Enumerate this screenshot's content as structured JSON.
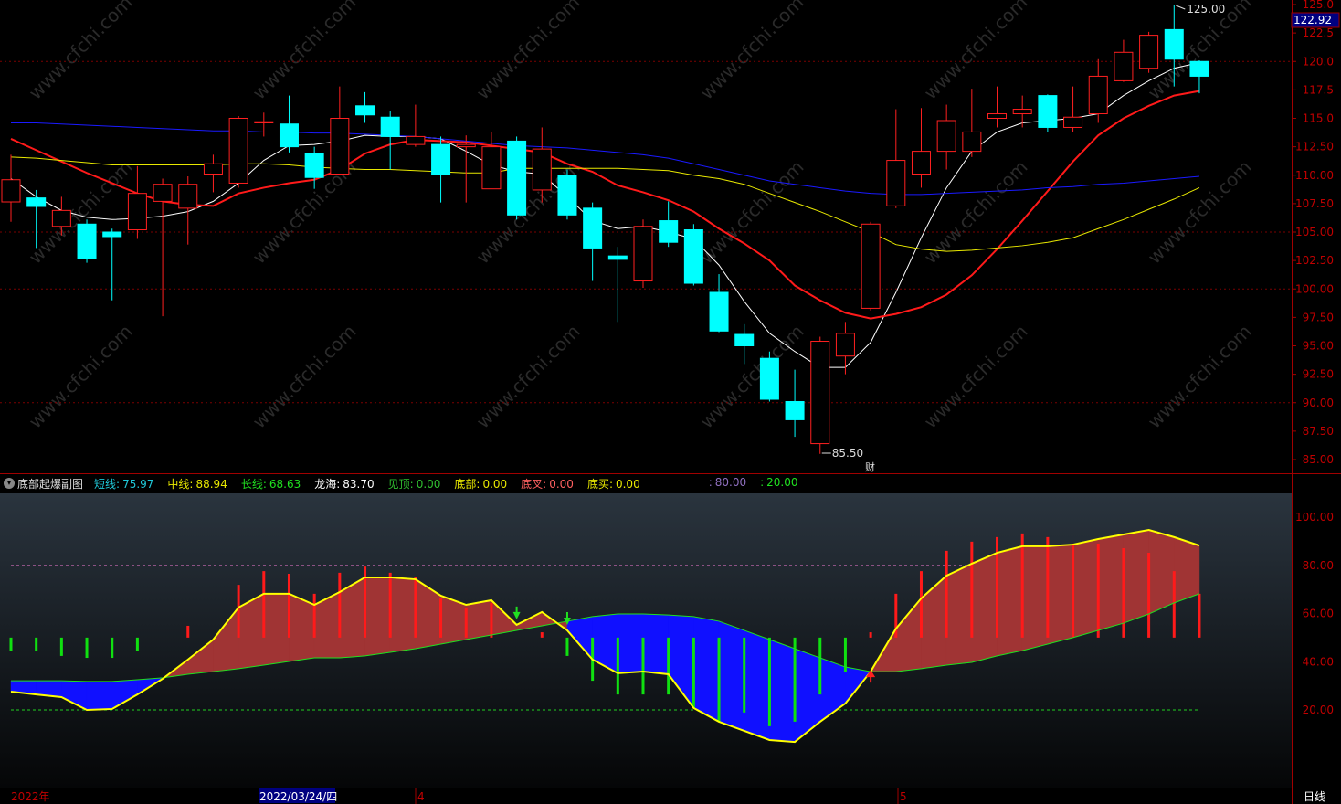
{
  "colors": {
    "up": "#ff2020",
    "down": "#00ffff",
    "ma5": "#ffffff",
    "ma10": "#ff1a1a",
    "ma20": "#e8e800",
    "ma60": "#1a1aff",
    "axis": "#a00000",
    "bg": "#000000"
  },
  "watermark": "www.cfchi.com",
  "price_axis": {
    "ticks": [
      "125.0",
      "122.5",
      "120.0",
      "117.5",
      "115.0",
      "112.50",
      "110.00",
      "107.50",
      "105.00",
      "102.50",
      "100.00",
      "97.50",
      "95.00",
      "92.50",
      "90.00",
      "87.50",
      "85.00"
    ],
    "current": "122.92"
  },
  "markers": {
    "high": "125.00",
    "low": "85.50",
    "event": "财"
  },
  "indicator": {
    "title": "底部起爆副图",
    "items": [
      {
        "label": "短线:",
        "value": "75.97",
        "color": "#20c8d8"
      },
      {
        "label": "中线:",
        "value": "88.94",
        "color": "#e8e800"
      },
      {
        "label": "长线:",
        "value": "68.63",
        "color": "#20e020"
      },
      {
        "label": "龙海:",
        "value": "83.70",
        "color": "#ffffff"
      },
      {
        "label": "见顶:",
        "value": "0.00",
        "color": "#30c030"
      },
      {
        "label": "底部:",
        "value": "0.00",
        "color": "#e8e800"
      },
      {
        "label": "底叉:",
        "value": "0.00",
        "color": "#ff6060"
      },
      {
        "label": "底买:",
        "value": "0.00",
        "color": "#e8e800"
      },
      {
        "label": ":",
        "value": "80.00",
        "color": "#9070c0"
      },
      {
        "label": ":",
        "value": "20.00",
        "color": "#20e020"
      }
    ],
    "axis_ticks": [
      "100.00",
      "80.00",
      "60.00",
      "40.00",
      "20.00"
    ]
  },
  "time_axis": {
    "labels": [
      "2022年",
      "4",
      "5"
    ],
    "cursor_date": "2022/03/24/四",
    "period": "日线"
  },
  "chart_data": [
    {
      "type": "candlestick",
      "title": "Price",
      "ylim": [
        85,
        125
      ],
      "candles": [
        [
          107.65,
          111.8,
          105.9,
          109.6
        ],
        [
          108.0,
          108.7,
          103.6,
          107.25
        ],
        [
          105.5,
          108.1,
          104.7,
          106.9
        ],
        [
          105.7,
          106.1,
          102.3,
          102.7
        ],
        [
          105.0,
          105.3,
          99.0,
          104.6
        ],
        [
          105.2,
          110.8,
          104.4,
          108.4
        ],
        [
          107.7,
          109.7,
          97.6,
          109.2
        ],
        [
          107.1,
          109.9,
          103.9,
          109.2
        ],
        [
          110.1,
          111.8,
          108.5,
          111.0
        ],
        [
          109.3,
          115.2,
          108.9,
          115.0
        ],
        [
          114.6,
          115.5,
          113.4,
          114.7
        ],
        [
          114.5,
          117.0,
          112.0,
          112.5
        ],
        [
          111.9,
          112.5,
          108.8,
          109.8
        ],
        [
          110.1,
          117.8,
          110.0,
          115.0
        ],
        [
          116.1,
          117.3,
          114.6,
          115.3
        ],
        [
          115.1,
          115.6,
          110.5,
          113.4
        ],
        [
          112.7,
          116.2,
          112.5,
          113.4
        ],
        [
          112.7,
          113.4,
          107.6,
          110.1
        ],
        [
          112.5,
          113.5,
          107.6,
          112.7
        ],
        [
          108.8,
          113.8,
          108.8,
          112.5
        ],
        [
          113.0,
          113.4,
          106.1,
          106.5
        ],
        [
          108.7,
          114.2,
          107.6,
          112.3
        ],
        [
          110.0,
          110.5,
          106.1,
          106.5
        ],
        [
          107.1,
          107.6,
          100.7,
          103.6
        ],
        [
          102.9,
          103.7,
          97.1,
          102.6
        ],
        [
          100.7,
          106.1,
          100.1,
          105.5
        ],
        [
          106.0,
          107.7,
          103.7,
          104.1
        ],
        [
          105.2,
          105.7,
          100.3,
          100.5
        ],
        [
          99.7,
          101.3,
          96.2,
          96.3
        ],
        [
          96.0,
          96.9,
          93.4,
          95.0
        ],
        [
          93.9,
          94.5,
          90.1,
          90.3
        ],
        [
          90.1,
          92.9,
          87.0,
          88.5
        ],
        [
          86.4,
          95.8,
          85.5,
          95.4
        ],
        [
          94.1,
          97.1,
          92.5,
          96.1
        ],
        [
          98.3,
          105.9,
          98.1,
          105.7
        ],
        [
          107.3,
          115.8,
          107.1,
          111.3
        ],
        [
          110.1,
          115.9,
          108.9,
          112.1
        ],
        [
          112.1,
          116.2,
          110.5,
          114.8
        ],
        [
          112.1,
          117.6,
          111.6,
          113.8
        ],
        [
          115.0,
          117.8,
          114.2,
          115.4
        ],
        [
          115.4,
          117.0,
          114.2,
          115.8
        ],
        [
          117.0,
          117.1,
          113.8,
          114.2
        ],
        [
          114.2,
          117.8,
          113.8,
          115.1
        ],
        [
          115.4,
          120.2,
          114.6,
          118.7
        ],
        [
          118.3,
          121.9,
          118.2,
          120.8
        ],
        [
          119.4,
          122.6,
          119.0,
          122.3
        ],
        [
          122.8,
          125.0,
          117.8,
          120.2
        ],
        [
          120.0,
          120.1,
          117.2,
          118.7
        ]
      ],
      "series": [
        {
          "name": "MA5",
          "values": [
            109.7,
            108.1,
            106.9,
            106.3,
            106.1,
            106.2,
            106.4,
            106.8,
            107.7,
            109.3,
            111.3,
            112.6,
            112.7,
            113.0,
            113.5,
            113.4,
            113.4,
            113.2,
            112.1,
            110.9,
            110.3,
            110.1,
            108.1,
            106.0,
            105.3,
            105.5,
            105.0,
            104.4,
            102.1,
            98.9,
            96.1,
            94.5,
            93.1,
            93.1,
            95.3,
            99.7,
            104.5,
            108.9,
            112.1,
            113.8,
            114.6,
            114.8,
            115.0,
            115.4,
            117.0,
            118.3,
            119.4,
            119.9
          ]
        },
        {
          "name": "MA10",
          "values": [
            113.2,
            112.2,
            111.2,
            110.2,
            109.3,
            108.4,
            107.7,
            107.4,
            107.3,
            108.4,
            108.9,
            109.3,
            109.6,
            110.5,
            111.9,
            112.7,
            113.1,
            113.0,
            112.9,
            112.6,
            112.3,
            112.0,
            111.0,
            110.3,
            109.1,
            108.5,
            107.8,
            106.8,
            105.3,
            104.0,
            102.5,
            100.3,
            99.0,
            97.9,
            97.4,
            97.8,
            98.4,
            99.5,
            101.2,
            103.5,
            106.0,
            108.6,
            111.2,
            113.5,
            115.0,
            116.1,
            117.0,
            117.4
          ]
        },
        {
          "name": "MA20",
          "values": [
            111.6,
            111.5,
            111.3,
            111.1,
            110.9,
            110.9,
            110.9,
            110.9,
            110.9,
            111.0,
            111.0,
            110.9,
            110.7,
            110.6,
            110.5,
            110.5,
            110.4,
            110.3,
            110.2,
            110.2,
            110.6,
            110.6,
            110.6,
            110.6,
            110.6,
            110.5,
            110.4,
            110.0,
            109.7,
            109.2,
            108.4,
            107.6,
            106.8,
            105.9,
            105.0,
            103.9,
            103.5,
            103.3,
            103.4,
            103.6,
            103.8,
            104.1,
            104.5,
            105.3,
            106.1,
            107.0,
            107.9,
            108.9
          ]
        },
        {
          "name": "MA60",
          "values": [
            114.6,
            114.6,
            114.5,
            114.4,
            114.3,
            114.2,
            114.1,
            114.0,
            113.9,
            113.9,
            113.8,
            113.8,
            113.7,
            113.7,
            113.6,
            113.5,
            113.4,
            113.2,
            113.0,
            112.8,
            112.6,
            112.5,
            112.4,
            112.2,
            112.0,
            111.8,
            111.5,
            111.0,
            110.5,
            110.0,
            109.5,
            109.2,
            108.9,
            108.6,
            108.4,
            108.3,
            108.3,
            108.4,
            108.5,
            108.6,
            108.7,
            108.9,
            109.0,
            109.2,
            109.3,
            109.5,
            109.7,
            109.9
          ]
        }
      ]
    },
    {
      "type": "line",
      "title": "底部起爆副图",
      "ylim": [
        0,
        110
      ],
      "reference_lines": [
        80,
        20
      ],
      "series": [
        {
          "name": "中线",
          "values": [
            27.6,
            26.4,
            25.3,
            20.0,
            20.4,
            26.4,
            32.9,
            40.9,
            49.2,
            62.5,
            68.2,
            68.2,
            63.6,
            68.9,
            75.0,
            75.0,
            74.2,
            67.4,
            63.6,
            65.5,
            55.3,
            60.6,
            53.0,
            40.9,
            35.2,
            35.9,
            34.8,
            20.8,
            15.1,
            11.3,
            7.5,
            6.7,
            15.1,
            22.7,
            35.9,
            53.7,
            66.3,
            75.7,
            80.7,
            85.2,
            87.9,
            87.9,
            88.6,
            90.9,
            92.8,
            94.7,
            91.7,
            88.2
          ]
        },
        {
          "name": "长线",
          "values": [
            32.1,
            32.1,
            32.1,
            31.8,
            31.8,
            32.5,
            33.3,
            34.8,
            35.9,
            37.1,
            38.6,
            40.1,
            41.6,
            41.6,
            42.4,
            43.9,
            45.4,
            47.3,
            49.2,
            51.1,
            53.0,
            54.9,
            56.8,
            58.7,
            59.8,
            59.8,
            59.4,
            58.7,
            56.8,
            53.0,
            49.2,
            45.4,
            41.6,
            37.8,
            35.9,
            35.9,
            37.1,
            38.6,
            39.7,
            42.4,
            44.6,
            47.3,
            50.0,
            53.0,
            56.0,
            59.8,
            64.4,
            68.2
          ]
        }
      ],
      "bars": {
        "base": 50,
        "values": [
          44.6,
          44.6,
          42.4,
          41.6,
          41.6,
          44.6,
          49.6,
          54.9,
          50,
          71.9,
          77.6,
          76.5,
          68.2,
          76.9,
          79.5,
          76.9,
          75.0,
          66.3,
          62.5,
          64.4,
          50,
          52.2,
          42.4,
          32.1,
          26.4,
          26.4,
          26.4,
          20.8,
          15.1,
          18.9,
          13.2,
          15.1,
          26.4,
          35.9,
          52.2,
          68.2,
          77.6,
          86.0,
          89.8,
          91.7,
          93.2,
          91.7,
          89.0,
          89.0,
          87.1,
          85.2,
          77.6,
          68.2
        ]
      },
      "signals": [
        {
          "index": 20,
          "type": "down"
        },
        {
          "index": 22,
          "type": "down"
        },
        {
          "index": 34,
          "type": "up"
        }
      ]
    }
  ]
}
